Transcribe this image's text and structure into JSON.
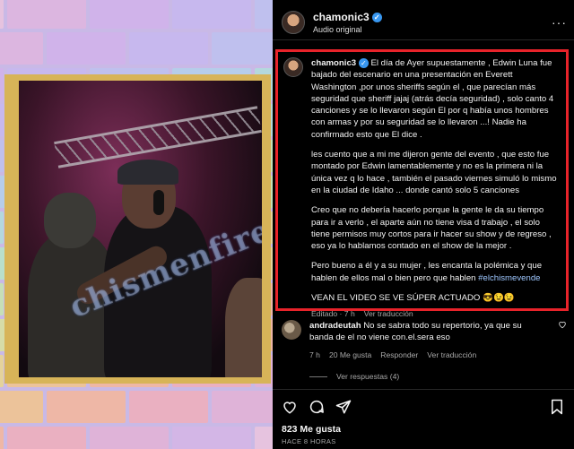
{
  "post": {
    "username": "chamonic3",
    "subtitle": "Audio original",
    "more": "···"
  },
  "media": {
    "watermark": "chismenfire"
  },
  "caption": {
    "username": "chamonic3",
    "p1": " El día de Ayer supuestamente , Edwin Luna fue bajado del escenario en una presentación en Everett Washington ,por unos sheriffs según el , que parecían más seguridad que sheriff jajaj (atrás decía seguridad) , solo canto 4 canciones y se lo llevaron según El por q había unos hombres con armas y por su seguridad se lo llevaron ...! Nadie ha confirmado esto que El dice .",
    "p2": "les cuento que a mi me dijeron gente del evento , que esto fue montado por Edwin lamentablemente y no es la primera ni la única vez q lo hace , también el pasado viernes simuló lo mismo en la ciudad de Idaho ... donde cantó solo 5 canciones",
    "p3": "Creo que no debería hacerlo porque la gente le da su tiempo para ir a verlo , el aparte aún no tiene visa d trabajo , el solo tiene permisos muy cortos para ir hacer su show y de regreso , eso ya lo hablamos contado en el show de la mejor .",
    "p4": "Pero bueno a él y a su mujer , les encanta la polémica y que hablen de ellos mal o bien pero que hablen ",
    "hashtag": "#elchismevende",
    "p5": "VEAN EL VIDEO SE VE SÚPER ACTUADO 😎😉😉",
    "edited": "Editado · 7 h",
    "translate": "Ver traducción"
  },
  "comment": {
    "username": "andradeutah",
    "text": " No se sabra todo su repertorio, ya que su banda de el no viene con.el.sera eso",
    "time": "7 h",
    "likes": "20 Me gusta",
    "reply": "Responder",
    "translate": "Ver traducción",
    "view_replies": "Ver respuestas (4)"
  },
  "footer": {
    "likes": "823 Me gusta",
    "ago": "HACE 8 HORAS"
  },
  "icons": {
    "heart": "heart-icon",
    "comment": "comment-icon",
    "share": "share-icon",
    "bookmark": "bookmark-icon",
    "verified": "verified-icon"
  },
  "colors": {
    "highlight_border": "#e8232a",
    "verified": "#3897f0",
    "hashtag": "#9ec7ff"
  }
}
